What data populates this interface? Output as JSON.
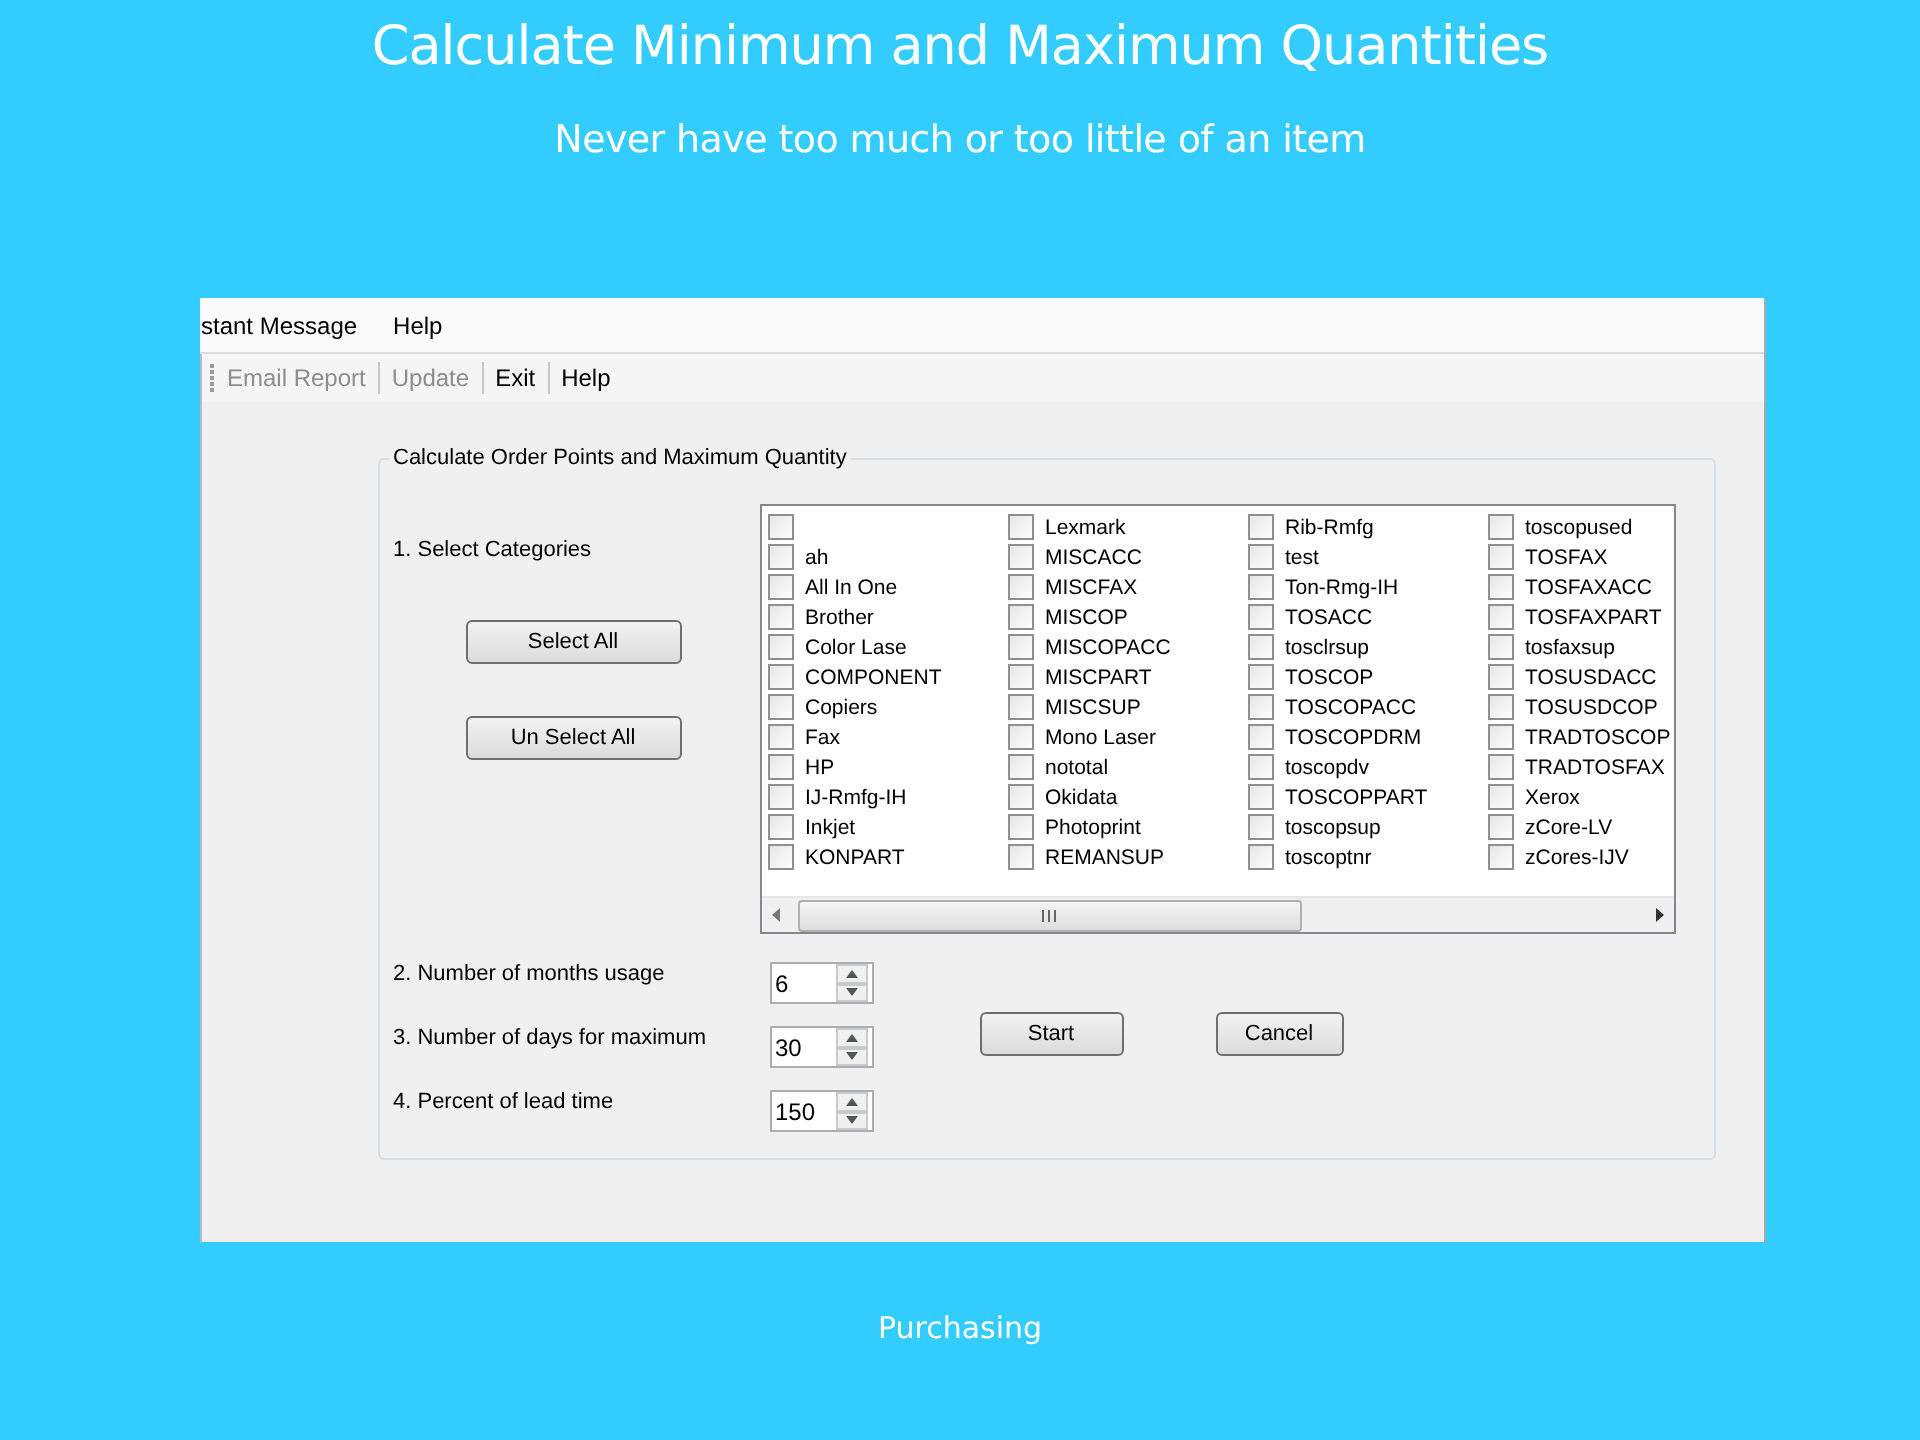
{
  "slide": {
    "title": "Calculate Minimum and Maximum Quantities",
    "subtitle": "Never have too much or too little of an item",
    "footer": "Purchasing"
  },
  "menu_bar": [
    "stant Message",
    "Help"
  ],
  "toolbar": [
    {
      "label": "Email Report",
      "disabled": true
    },
    {
      "label": "Update",
      "disabled": true
    },
    {
      "label": "Exit",
      "disabled": false
    },
    {
      "label": "Help",
      "disabled": false
    }
  ],
  "group": {
    "title": "Calculate Order Points and Maximum Quantity",
    "step_1": "1.  Select Categories",
    "buttons": [
      "Select All",
      "Un Select All"
    ]
  },
  "categories": [
    [
      {
        "checked": false
      },
      {
        "label": "ah",
        "checked": false
      },
      {
        "label": "All In One",
        "checked": false
      },
      {
        "label": "Brother",
        "checked": false
      },
      {
        "label": "Color Lase",
        "checked": false
      },
      {
        "label": "COMPONENT",
        "checked": false
      },
      {
        "label": "Copiers",
        "checked": false
      },
      {
        "label": "Fax",
        "checked": false
      },
      {
        "label": "HP",
        "checked": false
      },
      {
        "label": "IJ-Rmfg-IH",
        "checked": false
      },
      {
        "label": "Inkjet",
        "checked": false
      },
      {
        "label": "KONPART",
        "checked": false
      }
    ],
    [
      {
        "label": "Lexmark",
        "checked": false
      },
      {
        "label": "MISCACC",
        "checked": false
      },
      {
        "label": "MISCFAX",
        "checked": false
      },
      {
        "label": "MISCOP",
        "checked": false
      },
      {
        "label": "MISCOPACC",
        "checked": false
      },
      {
        "label": "MISCPART",
        "checked": false
      },
      {
        "label": "MISCSUP",
        "checked": false
      },
      {
        "label": "Mono Laser",
        "checked": false
      },
      {
        "label": "nototal",
        "checked": false
      },
      {
        "label": "Okidata",
        "checked": false
      },
      {
        "label": "Photoprint",
        "checked": false
      },
      {
        "label": "REMANSUP",
        "checked": false
      }
    ],
    [
      {
        "label": "Rib-Rmfg",
        "checked": false
      },
      {
        "label": "test",
        "checked": false
      },
      {
        "label": "Ton-Rmg-IH",
        "checked": false
      },
      {
        "label": "TOSACC",
        "checked": false
      },
      {
        "label": "tosclrsup",
        "checked": false
      },
      {
        "label": "TOSCOP",
        "checked": false
      },
      {
        "label": "TOSCOPACC",
        "checked": false
      },
      {
        "label": "TOSCOPDRM",
        "checked": false
      },
      {
        "label": "toscopdv",
        "checked": false
      },
      {
        "label": "TOSCOPPART",
        "checked": false
      },
      {
        "label": "toscopsup",
        "checked": false
      },
      {
        "label": "toscoptnr",
        "checked": false
      }
    ],
    [
      {
        "label": "toscopused",
        "checked": false
      },
      {
        "label": "TOSFAX",
        "checked": false
      },
      {
        "label": "TOSFAXACC",
        "checked": false
      },
      {
        "label": "TOSFAXPART",
        "checked": false
      },
      {
        "label": "tosfaxsup",
        "checked": false
      },
      {
        "label": "TOSUSDACC",
        "checked": false
      },
      {
        "label": "TOSUSDCOP",
        "checked": false
      },
      {
        "label": "TRADTOSCOP",
        "checked": false
      },
      {
        "label": "TRADTOSFAX",
        "checked": false
      },
      {
        "label": "Xerox",
        "checked": false
      },
      {
        "label": "zCore-LV",
        "checked": false
      },
      {
        "label": "zCores-IJV",
        "checked": false
      }
    ]
  ],
  "settings": [
    {
      "label": "2. Number of months usage",
      "value": "6"
    },
    {
      "label": "3.  Number of days for maximum",
      "value": "30"
    },
    {
      "label": "4.  Percent of lead time",
      "value": "150"
    }
  ],
  "actions": [
    "Start",
    "Cancel"
  ]
}
